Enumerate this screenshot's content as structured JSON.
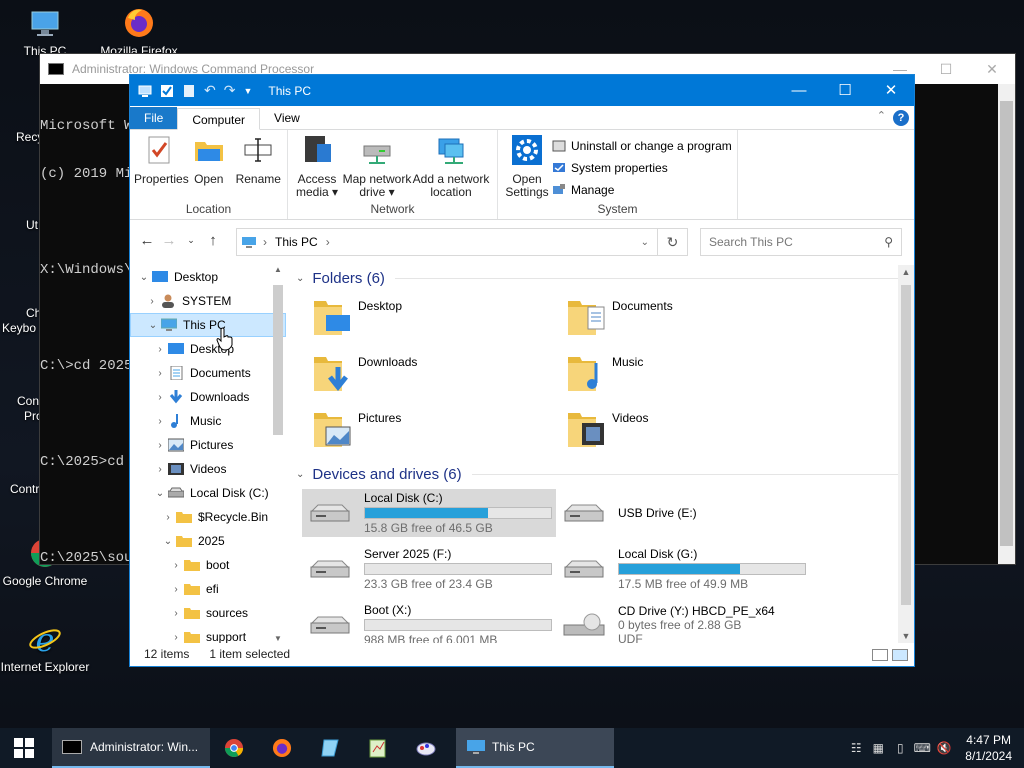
{
  "desktop": {
    "icons": [
      {
        "label": "This PC"
      },
      {
        "label": "Mozilla Firefox"
      },
      {
        "label": "Google Chrome"
      },
      {
        "label": "Internet Explorer"
      }
    ],
    "partial_labels": [
      "Recy",
      "Ut",
      "Ch",
      "Keybo",
      "Con",
      "Pro",
      "Contr"
    ]
  },
  "cmd": {
    "title": "Administrator: Windows Command Processor",
    "lines": [
      "Microsoft W",
      "(c) 2019 Mi",
      "",
      "X:\\Windows\\",
      "",
      "C:\\>cd 2025",
      "",
      "C:\\2025>cd s",
      "",
      "C:\\2025\\sou"
    ]
  },
  "explorer": {
    "title": "This PC",
    "tabs": {
      "file": "File",
      "computer": "Computer",
      "view": "View"
    },
    "ribbon": {
      "location": {
        "label": "Location",
        "properties": "Properties",
        "open": "Open",
        "rename": "Rename"
      },
      "network": {
        "label": "Network",
        "access_media": "Access media ▾",
        "map_drive": "Map network drive ▾",
        "add_location": "Add a network location"
      },
      "system": {
        "label": "System",
        "open_settings": "Open Settings",
        "uninstall": "Uninstall or change a program",
        "system_properties": "System properties",
        "manage": "Manage"
      }
    },
    "address": {
      "path": "This PC",
      "search_placeholder": "Search This PC"
    },
    "nav": [
      {
        "label": "Desktop",
        "indent": 0,
        "chev": "⌄",
        "icon": "desktop"
      },
      {
        "label": "SYSTEM",
        "indent": 1,
        "chev": "›",
        "icon": "user"
      },
      {
        "label": "This PC",
        "indent": 1,
        "chev": "⌄",
        "icon": "pc",
        "selected": true
      },
      {
        "label": "Desktop",
        "indent": 2,
        "chev": "›",
        "icon": "desktop"
      },
      {
        "label": "Documents",
        "indent": 2,
        "chev": "›",
        "icon": "docs"
      },
      {
        "label": "Downloads",
        "indent": 2,
        "chev": "›",
        "icon": "download"
      },
      {
        "label": "Music",
        "indent": 2,
        "chev": "›",
        "icon": "music"
      },
      {
        "label": "Pictures",
        "indent": 2,
        "chev": "›",
        "icon": "pictures"
      },
      {
        "label": "Videos",
        "indent": 2,
        "chev": "›",
        "icon": "videos"
      },
      {
        "label": "Local Disk (C:)",
        "indent": 2,
        "chev": "⌄",
        "icon": "drive"
      },
      {
        "label": "$Recycle.Bin",
        "indent": 3,
        "chev": "›",
        "icon": "folder"
      },
      {
        "label": "2025",
        "indent": 3,
        "chev": "⌄",
        "icon": "folder"
      },
      {
        "label": "boot",
        "indent": 4,
        "chev": "›",
        "icon": "folder"
      },
      {
        "label": "efi",
        "indent": 4,
        "chev": "›",
        "icon": "folder"
      },
      {
        "label": "sources",
        "indent": 4,
        "chev": "›",
        "icon": "folder"
      },
      {
        "label": "support",
        "indent": 4,
        "chev": "›",
        "icon": "folder"
      }
    ],
    "folders_header": "Folders (6)",
    "folders": [
      {
        "name": "Desktop",
        "icon": "desktop"
      },
      {
        "name": "Documents",
        "icon": "docs"
      },
      {
        "name": "Downloads",
        "icon": "download"
      },
      {
        "name": "Music",
        "icon": "music"
      },
      {
        "name": "Pictures",
        "icon": "pictures"
      },
      {
        "name": "Videos",
        "icon": "videos"
      }
    ],
    "drives_header": "Devices and drives (6)",
    "drives": [
      {
        "name": "Local Disk (C:)",
        "free": "15.8 GB free of 46.5 GB",
        "used_fraction": 0.66,
        "selected": true,
        "bar": true
      },
      {
        "name": "USB Drive (E:)",
        "free": "",
        "used_fraction": 0,
        "bar": false
      },
      {
        "name": "Server 2025 (F:)",
        "free": "23.3 GB free of 23.4 GB",
        "used_fraction": 0.0,
        "bar": true
      },
      {
        "name": "Local Disk (G:)",
        "free": "17.5 MB free of 49.9 MB",
        "used_fraction": 0.65,
        "bar": true
      },
      {
        "name": "Boot (X:)",
        "free": "988 MB free of 6.001 MB",
        "used_fraction": 0.0,
        "bar": true
      },
      {
        "name": "CD Drive (Y:) HBCD_PE_x64",
        "free": "0 bytes free of 2.88 GB",
        "used_fraction": 0,
        "bar": false,
        "extra": "UDF"
      }
    ],
    "status": {
      "count": "12 items",
      "selected": "1 item selected"
    }
  },
  "taskbar": {
    "cmd_label": "Administrator: Win...",
    "pc_label": "This PC",
    "time": "4:47 PM",
    "date": "8/1/2024"
  }
}
